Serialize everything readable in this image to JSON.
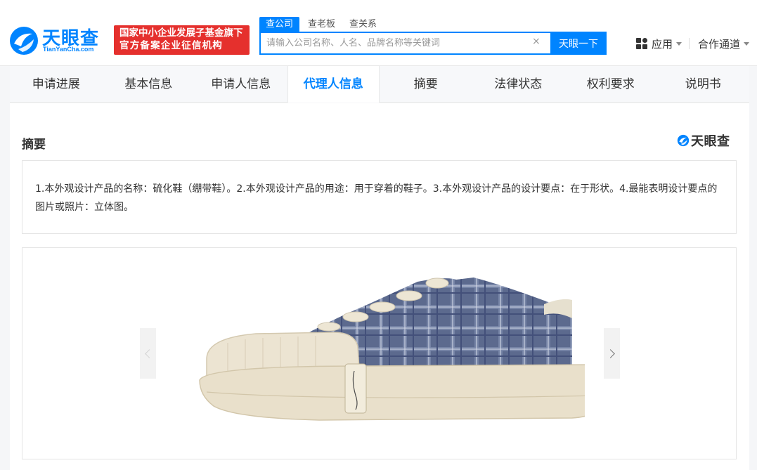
{
  "brand": {
    "name": "天眼查",
    "sub": "TianYanCha.com"
  },
  "slogan": {
    "line1": "国家中小企业发展子基金旗下",
    "line2": "官方备案企业征信机构"
  },
  "search": {
    "tabs": [
      {
        "label": "查公司",
        "active": true
      },
      {
        "label": "查老板",
        "active": false
      },
      {
        "label": "查关系",
        "active": false
      }
    ],
    "placeholder": "请输入公司名称、人名、品牌名称等关键词",
    "clear_glyph": "×",
    "button_label": "天眼一下"
  },
  "nav": {
    "apps_label": "应用",
    "partner_label": "合作通道"
  },
  "tabs": [
    {
      "label": "申请进展",
      "active": false
    },
    {
      "label": "基本信息",
      "active": false
    },
    {
      "label": "申请人信息",
      "active": false
    },
    {
      "label": "代理人信息",
      "active": true
    },
    {
      "label": "摘要",
      "active": false
    },
    {
      "label": "法律状态",
      "active": false
    },
    {
      "label": "权利要求",
      "active": false
    },
    {
      "label": "说明书",
      "active": false
    }
  ],
  "abstract": {
    "title": "摘要",
    "brand": "天眼查",
    "text": "1.本外观设计产品的名称：硫化鞋（绷带鞋）。2.本外观设计产品的用途：用于穿着的鞋子。3.本外观设计产品的设计要点：在于形状。4.最能表明设计要点的图片或照片：立体图。"
  },
  "colors": {
    "accent": "#0084ff",
    "slogan_bg": "#e5302d",
    "active_tab_text": "#0084ff"
  }
}
